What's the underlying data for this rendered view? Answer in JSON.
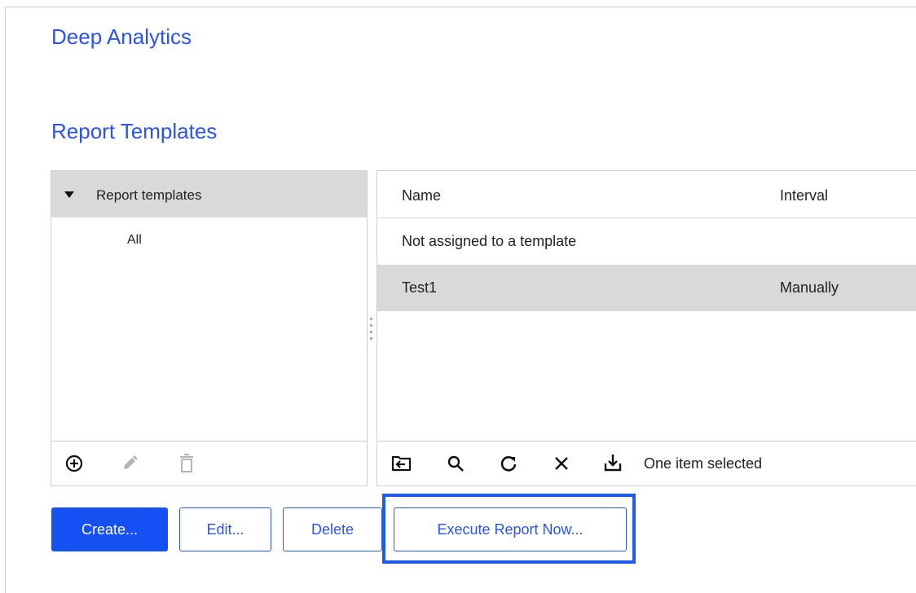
{
  "app": {
    "title": "Deep Analytics"
  },
  "section": {
    "title": "Report Templates"
  },
  "tree": {
    "root_label": "Report templates",
    "children": [
      "All"
    ]
  },
  "table": {
    "columns": [
      "Name",
      "Interval"
    ],
    "rows": [
      {
        "name": "Not assigned to a template",
        "interval": ""
      },
      {
        "name": "Test1",
        "interval": "Manually",
        "selected": true
      }
    ]
  },
  "left_toolbar": {
    "icons": [
      "add-circle-icon",
      "pencil-icon",
      "trash-icon"
    ]
  },
  "right_toolbar": {
    "icons": [
      "move-to-folder-icon",
      "search-icon",
      "refresh-icon",
      "close-icon",
      "download-icon"
    ],
    "status": "One item selected"
  },
  "buttons": {
    "create": "Create...",
    "edit": "Edit...",
    "delete": "Delete",
    "execute": "Execute Report Now..."
  },
  "colors": {
    "accent": "#2a53ee",
    "primary_button": "#1550f2",
    "highlight": "#1f5bea",
    "selected_row": "#d9d9d9"
  }
}
